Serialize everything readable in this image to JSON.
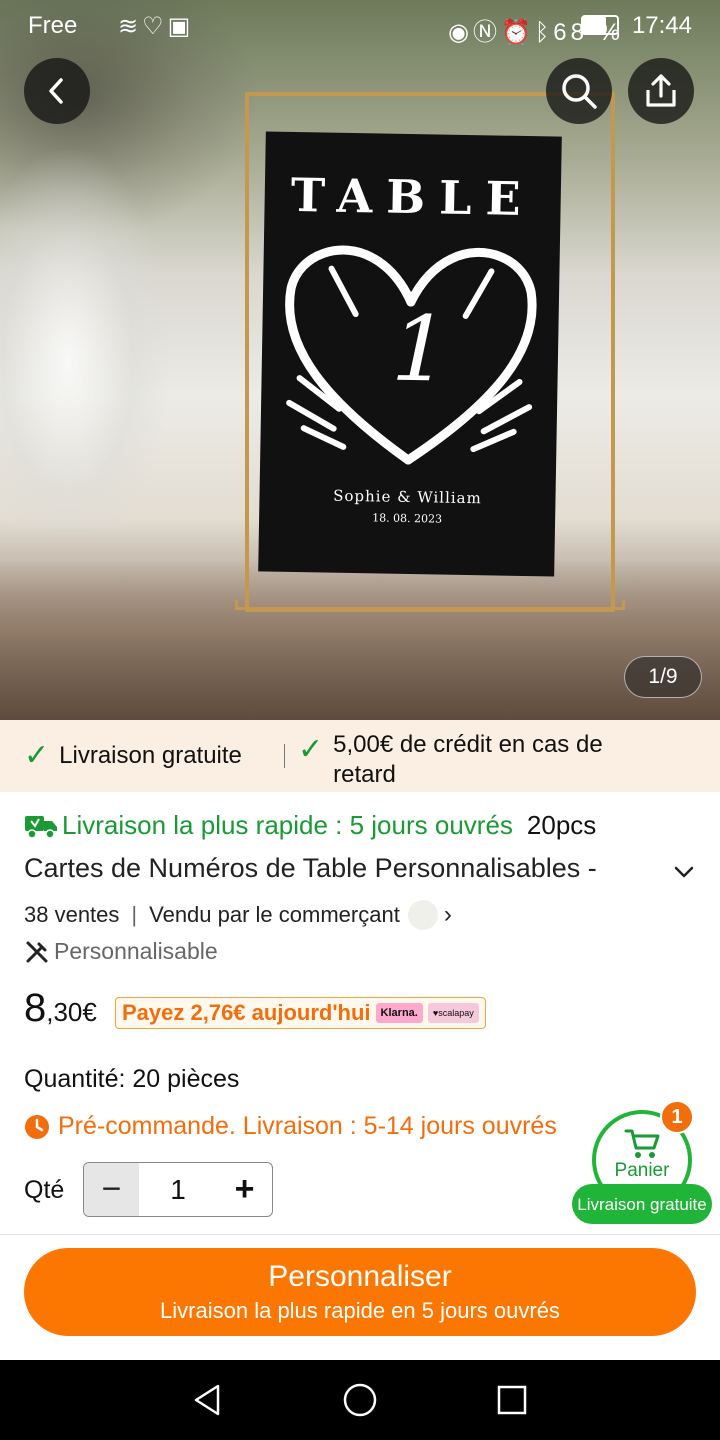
{
  "status_bar": {
    "carrier": "Free",
    "battery": "68 %",
    "battery_level": 0.68,
    "time": "17:44"
  },
  "hero": {
    "counter": "1/9",
    "card_title": "TABLE",
    "card_number": "1",
    "card_names": "Sophie & William",
    "card_date": "18. 08. 2023"
  },
  "banner": {
    "free_delivery": "Livraison gratuite",
    "credit": "5,00€ de crédit en cas de retard"
  },
  "product": {
    "fastest_delivery": "Livraison la plus rapide : 5 jours ouvrés",
    "pack": "20pcs",
    "title": "Cartes de Numéros de Table Personnalisables -",
    "sales": "38 ventes",
    "seller": "Vendu par le commerçant",
    "customizable": "Personnalisable",
    "price_int": "8",
    "price_dec": ",30€",
    "pay_today": "Payez 2,76€ aujourd'hui",
    "klarna": "Klarna.",
    "scalapay": "♥scalapay",
    "quantity_label": "Quantité: 20 pièces",
    "preorder": "Pré-commande. Livraison :  5-14 jours ouvrés",
    "qty_label": "Qté",
    "qty_value": "1"
  },
  "cart": {
    "label": "Panier",
    "badge": "1",
    "pill": "Livraison gratuite"
  },
  "cta": {
    "label": "Personnaliser",
    "sublabel": "Livraison la plus rapide en 5 jours ouvrés"
  },
  "colors": {
    "accent": "#fb7701",
    "green": "#1a9a35",
    "banner_bg": "#fbeee3"
  }
}
